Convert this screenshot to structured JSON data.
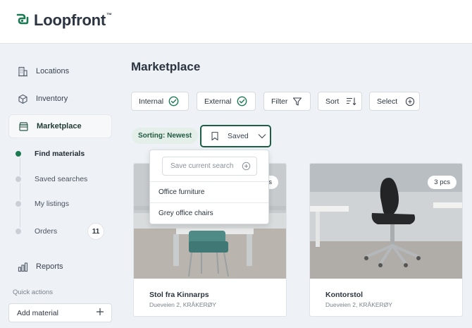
{
  "brand": {
    "name": "Loopfront",
    "tm": "™",
    "color": "#1b7a52"
  },
  "sidebar": {
    "items": [
      {
        "label": "Locations",
        "icon": "building-icon"
      },
      {
        "label": "Inventory",
        "icon": "box-icon"
      },
      {
        "label": "Marketplace",
        "icon": "storefront-icon",
        "active": true
      },
      {
        "label": "Reports",
        "icon": "bar-chart-icon"
      }
    ],
    "sub_items": [
      {
        "label": "Find materials",
        "active": true
      },
      {
        "label": "Saved searches"
      },
      {
        "label": "My listings"
      },
      {
        "label": "Orders",
        "badge": "11"
      }
    ],
    "quick_actions_title": "Quick actions",
    "add_material_label": "Add material"
  },
  "main": {
    "title": "Marketplace",
    "filters": [
      {
        "label": "Internal",
        "icon": "check-circle-icon"
      },
      {
        "label": "External",
        "icon": "check-circle-icon"
      },
      {
        "label": "Filter",
        "icon": "funnel-icon"
      },
      {
        "label": "Sort",
        "icon": "sort-icon"
      },
      {
        "label": "Select",
        "icon": "plus-circle-icon"
      }
    ],
    "sorting_label": "Sorting: Newest",
    "saved_label": "Saved",
    "dropdown": {
      "save_placeholder": "Save current search",
      "items": [
        "Office furniture",
        "Grey office chairs"
      ]
    },
    "cards": [
      {
        "title": "Stol fra Kinnarps",
        "address": "Dueveien 2, KRÅKERØY",
        "qty": "3 pcs"
      },
      {
        "title": "Kontorstol",
        "address": "Dueveien 2, KRÅKERØY",
        "qty": "3 pcs"
      }
    ]
  },
  "colors": {
    "accent": "#1b7a52",
    "accent_dark": "#1d5f45",
    "background": "#eef1f5"
  }
}
